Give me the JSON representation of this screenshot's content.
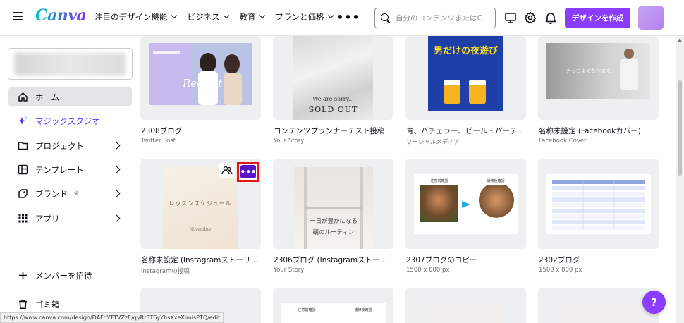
{
  "header": {
    "logo": "Canva",
    "nav": [
      {
        "label": "注目のデザイン機能"
      },
      {
        "label": "ビジネス"
      },
      {
        "label": "教育"
      },
      {
        "label": "プランと価格"
      }
    ],
    "more": "•••",
    "search_placeholder": "自分のコンテンツまたはC",
    "create_button": "デザインを作成"
  },
  "sidebar": {
    "items": [
      {
        "label": "ホーム"
      },
      {
        "label": "マジックスタジオ"
      },
      {
        "label": "プロジェクト"
      },
      {
        "label": "テンプレート"
      },
      {
        "label": "ブランド"
      },
      {
        "label": "アプリ"
      }
    ],
    "invite": "メンバーを招待",
    "trash": "ゴミ箱"
  },
  "cards": [
    {
      "title": "2308ブログ",
      "sub": "Twitter Post"
    },
    {
      "title": "コンテンツプランナーテスト投稿",
      "sub": "Your Story",
      "thumb_text_1": "We are sorry...",
      "thumb_text_2": "SOLD OUT"
    },
    {
      "title": "青、バチェラー、ビール・パーティ...",
      "sub": "ソーシャルメディア",
      "thumb_text": "男だけの夜遊び"
    },
    {
      "title": "名称未設定 (Facebookカバー)",
      "sub": "Facebook Cover",
      "thumb_text": "カッコよくなります。"
    },
    {
      "title": "名称未設定 (Instagramストーリー) ...",
      "sub": "Instagramの投稿",
      "thumb_text_1": "レッスンスケジュール",
      "thumb_text_2": "November"
    },
    {
      "title": "2306ブログ (Instagramストーリー)",
      "sub": "Your Story",
      "thumb_text_1": "一日が豊かになる",
      "thumb_text_2": "朝のルーティン"
    },
    {
      "title": "2307ブログのコピー",
      "sub": "1500 x 800 px",
      "thumb_text_1": "注意前確認",
      "thumb_text_2": "補修後確認"
    },
    {
      "title": "2302ブログ",
      "sub": "1500 x 800 px"
    },
    {
      "title": "",
      "sub": "",
      "thumb_text_1": "注意前確認",
      "thumb_text_2": "補修後確認"
    }
  ],
  "status_url": "https://www.canva.com/design/DAFoYTTVZzE/qyRr3T6yYhsXxeXlmisPTQ/edit",
  "help": "?",
  "colors": {
    "brand": "#8b3dff",
    "accent": "#00c4cc",
    "highlight": "#e5161a"
  }
}
